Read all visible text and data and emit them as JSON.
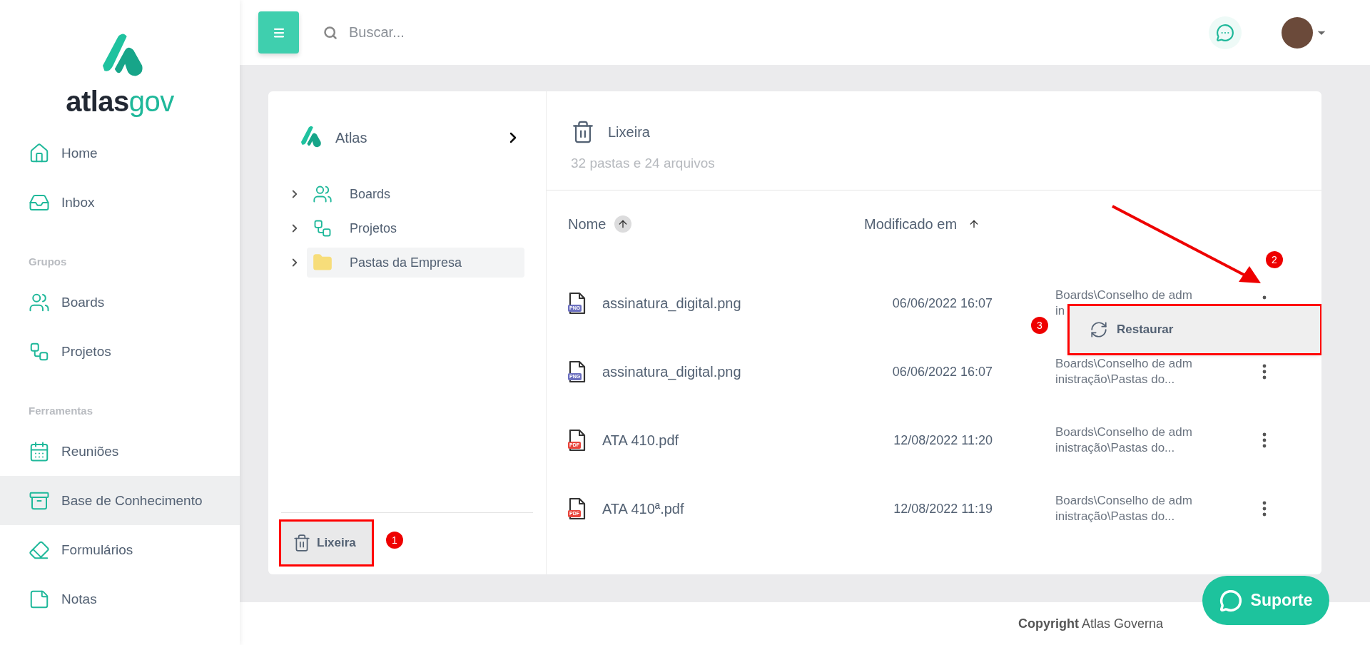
{
  "logo": {
    "text_dark": "atlas",
    "text_light": "gov"
  },
  "sidebar": {
    "sections": [
      {
        "items": [
          {
            "label": "Home",
            "selected": false
          },
          {
            "label": "Inbox",
            "selected": false
          }
        ]
      },
      {
        "header": "Grupos",
        "items": [
          {
            "label": "Boards",
            "selected": false
          },
          {
            "label": "Projetos",
            "selected": false
          }
        ]
      },
      {
        "header": "Ferramentas",
        "items": [
          {
            "label": "Reuniões",
            "selected": false
          },
          {
            "label": "Base de Conhecimento",
            "selected": true
          },
          {
            "label": "Formulários",
            "selected": false
          },
          {
            "label": "Notas",
            "selected": false
          }
        ]
      }
    ]
  },
  "topbar": {
    "search": {
      "placeholder": "Buscar..."
    }
  },
  "explorer": {
    "workspace": "Atlas",
    "tree": [
      {
        "label": "Boards",
        "selected": false,
        "expanded": false
      },
      {
        "label": "Projetos",
        "selected": false,
        "expanded": false
      },
      {
        "label": "Pastas da Empresa",
        "selected": true,
        "expanded": false
      }
    ],
    "trash_button": {
      "label": "Lixeira",
      "selected": true
    }
  },
  "folder": {
    "title": "Lixeira",
    "summary": "32 pastas e 24 arquivos",
    "sort_columns": [
      {
        "label": "Nome",
        "selected": true
      },
      {
        "label": "Modificado em",
        "selected": false
      }
    ],
    "rows": [
      {
        "name": "assinatura_digital.png",
        "kind": "png",
        "badge": "PNG",
        "modified": "06/06/2022 16:07",
        "location": [
          "Boards\\Conselho de adm",
          "in"
        ],
        "menu_open": true
      },
      {
        "name": "assinatura_digital.png",
        "kind": "png",
        "badge": "PNG",
        "modified": "06/06/2022 16:07",
        "location": [
          "Boards\\Conselho de adm",
          "inistração\\Pastas do..."
        ],
        "menu_open": false
      },
      {
        "name": "ATA 410.pdf",
        "kind": "pdf",
        "badge": "PDF",
        "modified": "12/08/2022 11:20",
        "location": [
          "Boards\\Conselho de adm",
          "inistração\\Pastas do..."
        ],
        "menu_open": false
      },
      {
        "name": "ATA 410ª.pdf",
        "kind": "pdf",
        "badge": "PDF",
        "modified": "12/08/2022 11:19",
        "location": [
          "Boards\\Conselho de adm",
          "inistração\\Pastas do..."
        ],
        "menu_open": false
      }
    ],
    "row_menu": [
      {
        "label": "Restaurar"
      }
    ]
  },
  "footer": {
    "bold": "Copyright",
    "text": "Atlas Governa"
  },
  "support_button": {
    "label": "Suporte"
  },
  "annotations": [
    {
      "number": "1"
    },
    {
      "number": "2"
    },
    {
      "number": "3"
    }
  ]
}
